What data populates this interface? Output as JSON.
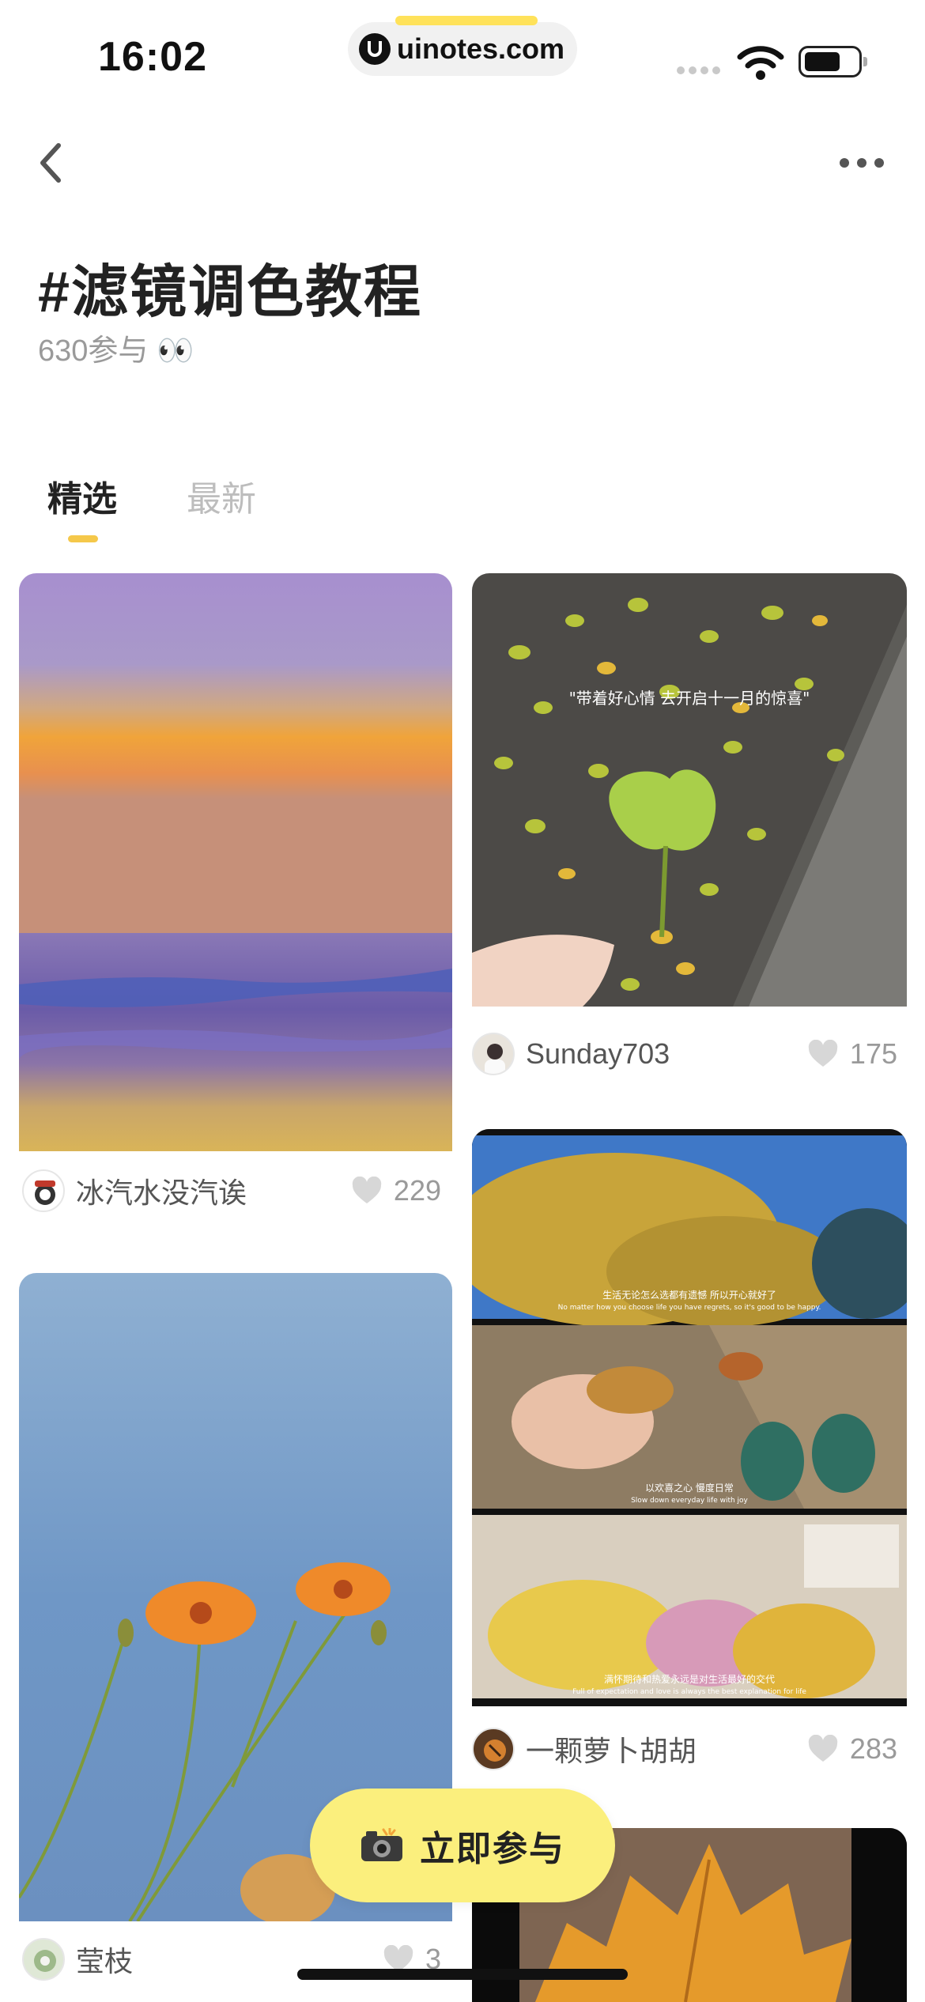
{
  "status_bar": {
    "time": "16:02",
    "url": "uinotes.com"
  },
  "header": {
    "title": "#滤镜调色教程",
    "subtitle": "630参与 👀"
  },
  "tabs": [
    {
      "label": "精选",
      "active": true
    },
    {
      "label": "最新",
      "active": false
    }
  ],
  "posts": [
    {
      "user": "冰汽水没汽诶",
      "likes": "229",
      "image": "sunset-sea-photo"
    },
    {
      "user": "Sunday703",
      "likes": "175",
      "image": "ginkgo-leaf-photo",
      "caption": "\"带着好心情 去开启十一月的惊喜\""
    },
    {
      "user": "一颗萝卜胡胡",
      "likes": "283",
      "image": "autumn-collage-photo",
      "captions": [
        "生活无论怎么选都有遗憾 所以开心就好了",
        "No matter how you choose life you have regrets, so it's good to be happy.",
        "以欢喜之心 慢度日常",
        "Slow down everyday life with joy",
        "满怀期待和热爱永远是对生活最好的交代",
        "Full of expectation and love is always the best explanation for life"
      ]
    },
    {
      "user": "莹枝",
      "likes": "3",
      "image": "orange-flowers-photo"
    }
  ],
  "join_button": {
    "label": "立即参与",
    "icon": "camera-icon"
  },
  "colors": {
    "accent": "#f5c84a",
    "button_bg": "#fbef7d",
    "muted": "#9a9a9a"
  }
}
